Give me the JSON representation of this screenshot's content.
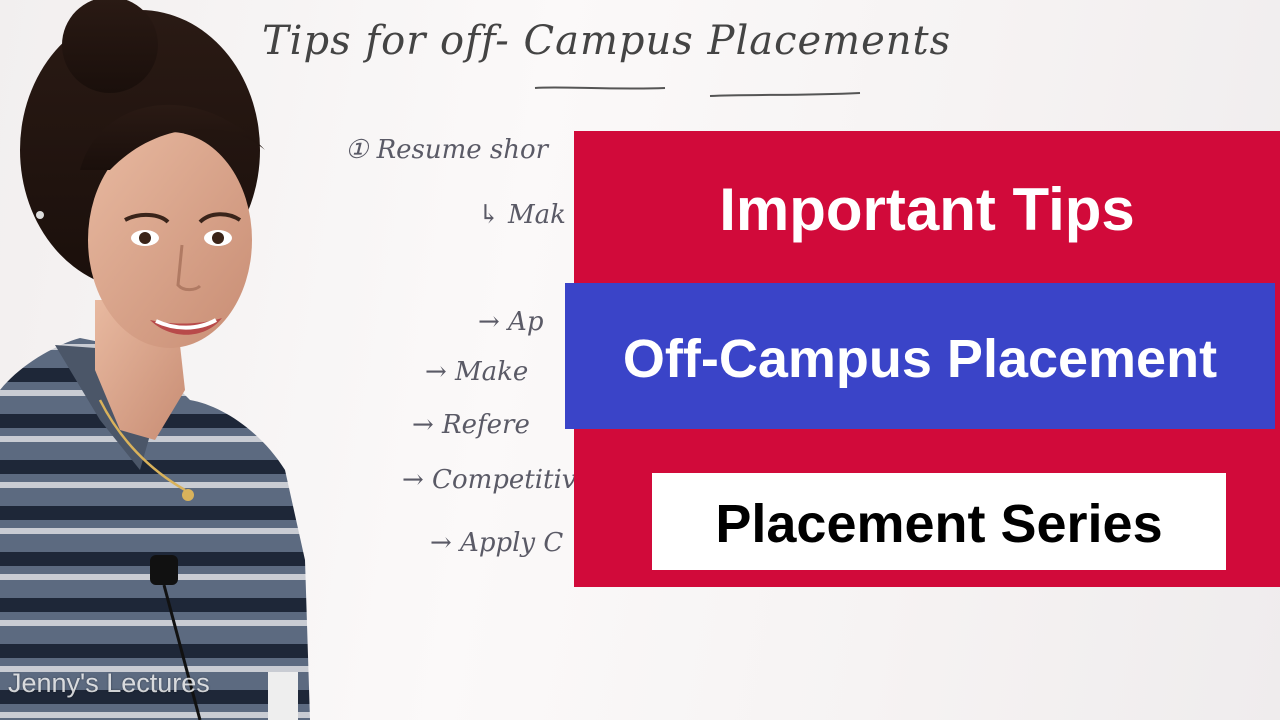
{
  "whiteboard": {
    "title": "Tips for off- Campus Placements",
    "lines": [
      "① Resume shor",
      "↳ Mak",
      "→ Ap",
      "→ Make",
      "→ Refere",
      "→ Competitive",
      "→ Apply C"
    ]
  },
  "overlay": {
    "headline": "Important Tips",
    "subject": "Off-Campus Placement",
    "series": "Placement Series",
    "colors": {
      "panel": "#d10a3a",
      "band": "#3a44c8",
      "box": "#ffffff"
    }
  },
  "watermark": "Jenny's Lectures"
}
